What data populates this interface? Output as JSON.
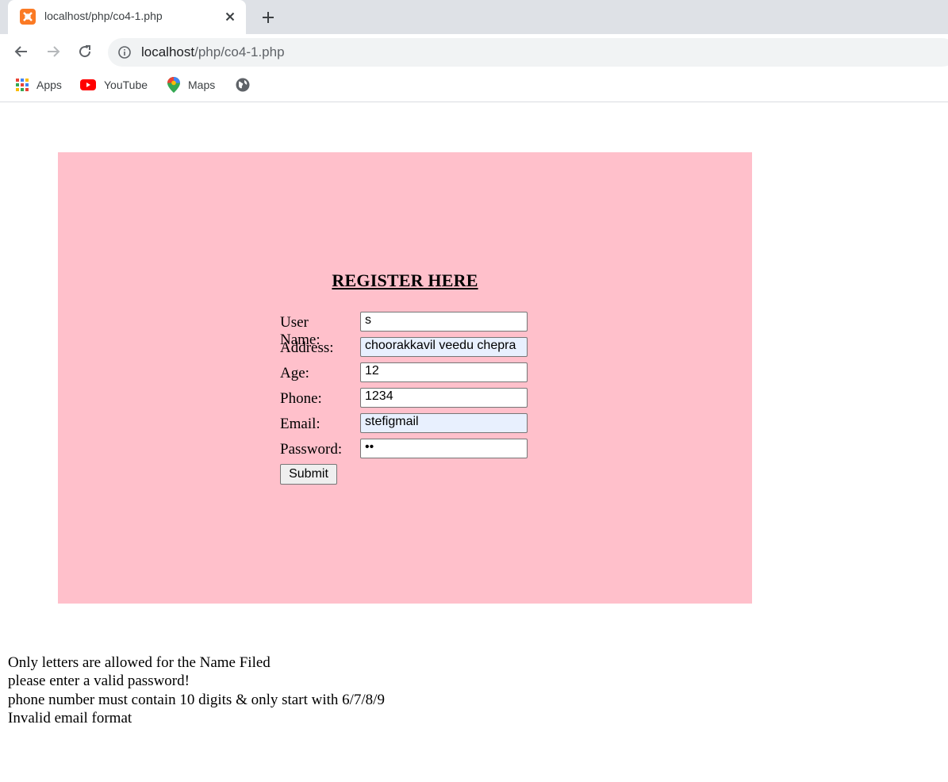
{
  "browser": {
    "tab_title": "localhost/php/co4-1.php",
    "url_host": "localhost",
    "url_path": "/php/co4-1.php",
    "bookmarks": [
      {
        "label": "Apps",
        "icon": "apps-grid-icon"
      },
      {
        "label": "YouTube",
        "icon": "youtube-icon"
      },
      {
        "label": "Maps",
        "icon": "maps-pin-icon"
      },
      {
        "label": "",
        "icon": "globe-icon"
      }
    ]
  },
  "form": {
    "heading": "REGISTER HERE",
    "fields": [
      {
        "label": "User Name:",
        "value": "s",
        "autofill": false
      },
      {
        "label": "Address:",
        "value": "choorakkavil veedu chepra",
        "autofill": true
      },
      {
        "label": "Age:",
        "value": "12",
        "autofill": false
      },
      {
        "label": "Phone:",
        "value": "1234",
        "autofill": false
      },
      {
        "label": "Email:",
        "value": "stefigmail",
        "autofill": true
      },
      {
        "label": "Password:",
        "value": "••",
        "autofill": false
      }
    ],
    "submit_label": "Submit"
  },
  "errors": [
    "Only letters are allowed for the Name Filed",
    "please enter a valid password!",
    "phone number must contain 10 digits & only start with 6/7/8/9",
    "Invalid email format"
  ],
  "colors": {
    "panel_bg": "#ffc0cb",
    "autofill_bg": "#e8f0fe",
    "tabstrip_bg": "#dee1e6"
  }
}
